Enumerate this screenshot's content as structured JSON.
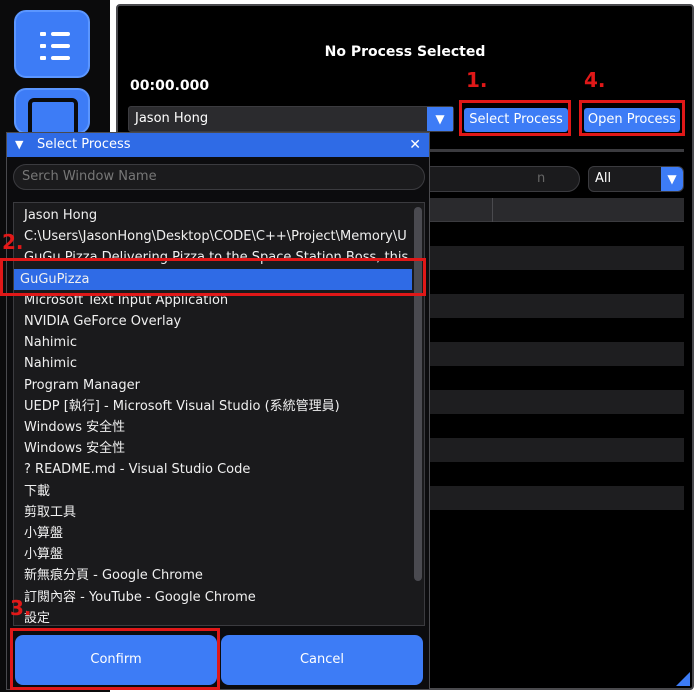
{
  "main": {
    "title": "No Process Selected",
    "timer": "00:00.000",
    "process_combo_value": "Jason Hong",
    "select_process_label": "Select Process",
    "open_process_label": "Open Process",
    "search_partial": "n",
    "filter_value": "All"
  },
  "annotations": {
    "step1": "1.",
    "step2": "2.",
    "step3": "3.",
    "step4": "4.",
    "color": "#e01818"
  },
  "dialog": {
    "title": "Select Process",
    "close_glyph": "✕",
    "search_placeholder": "Serch Window Name",
    "items": [
      "Jason Hong",
      "C:\\Users\\JasonHong\\Desktop\\CODE\\C++\\Project\\Memory\\UEDP",
      "GuGu Pizza Delivering Pizza to the Space Station Boss, this is ju",
      "GuGuPizza",
      "Microsoft Text Input Application",
      "NVIDIA GeForce Overlay",
      "Nahimic",
      "Nahimic",
      "Program Manager",
      "UEDP [執行] - Microsoft Visual Studio (系統管理員)",
      "Windows 安全性",
      "Windows 安全性",
      "? README.md - Visual Studio Code",
      "下載",
      "剪取工具",
      "小算盤",
      "小算盤",
      "新無痕分頁 - Google Chrome",
      "訂閱內容 - YouTube - Google Chrome",
      "設定"
    ],
    "selected_index": 3,
    "confirm_label": "Confirm",
    "cancel_label": "Cancel"
  },
  "colors": {
    "accent": "#3d7cf6",
    "title_bar": "#2f6be6",
    "background": "#000000"
  }
}
